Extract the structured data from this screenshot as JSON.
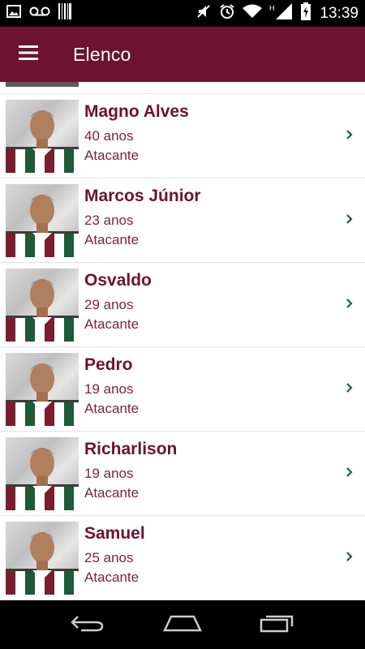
{
  "status_bar": {
    "time": "13:39",
    "left_icons": [
      "image-icon",
      "voicemail-icon",
      "barcode-icon"
    ],
    "right_icons": [
      "mute-icon",
      "alarm-icon",
      "wifi-icon",
      "signal-icon",
      "battery-charging-icon"
    ]
  },
  "app_bar": {
    "title": "Elenco",
    "menu_icon": "menu-icon",
    "background": "#6d1231"
  },
  "players": [
    {
      "name": "Magno Alves",
      "age": "40 anos",
      "position": "Atacante"
    },
    {
      "name": "Marcos Júnior",
      "age": "23 anos",
      "position": "Atacante"
    },
    {
      "name": "Osvaldo",
      "age": "29 anos",
      "position": "Atacante"
    },
    {
      "name": "Pedro",
      "age": "19 anos",
      "position": "Atacante"
    },
    {
      "name": "Richarlison",
      "age": "19 anos",
      "position": "Atacante"
    },
    {
      "name": "Samuel",
      "age": "25 anos",
      "position": "Atacante"
    }
  ],
  "colors": {
    "accent": "#6d1231",
    "chevron": "#1f5e3a"
  },
  "nav_bar": {
    "buttons": [
      "back-icon",
      "home-icon",
      "recents-icon"
    ]
  }
}
